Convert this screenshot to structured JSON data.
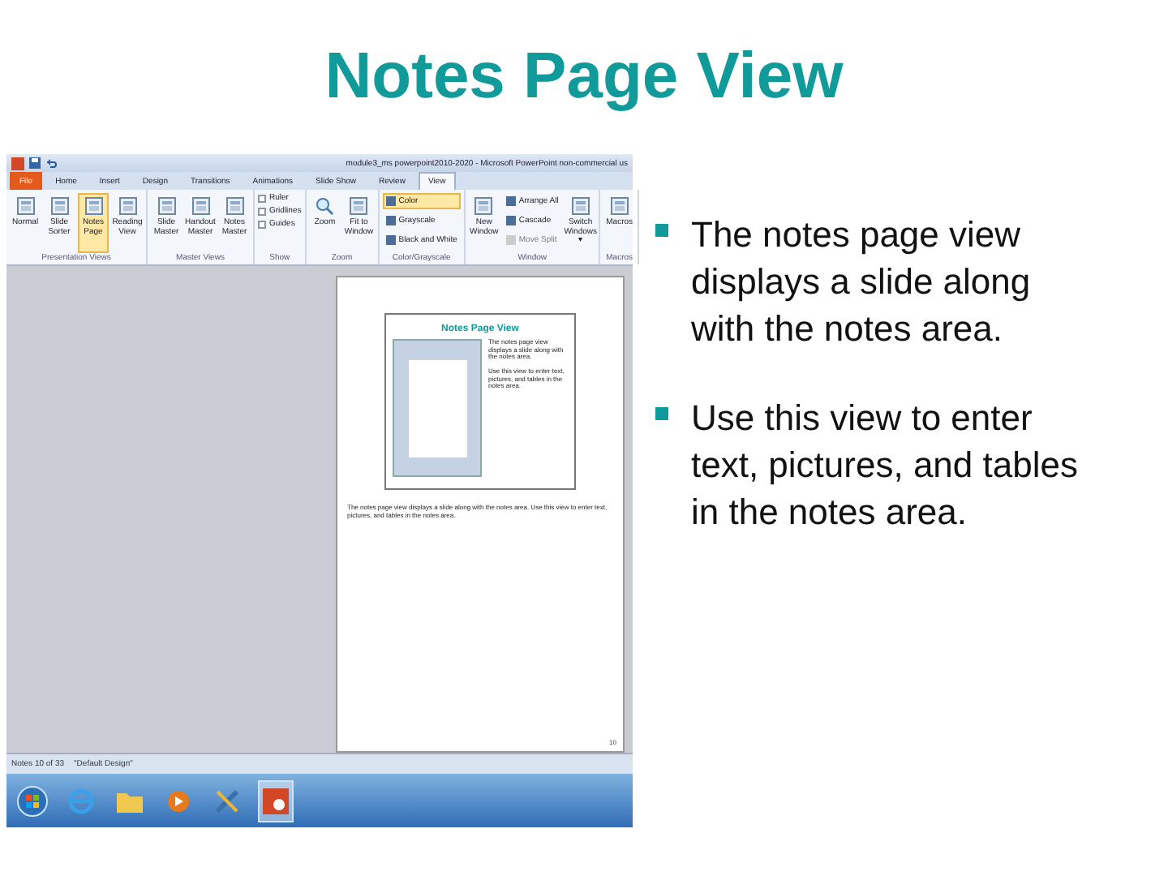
{
  "slide": {
    "title": "Notes Page View",
    "bullets": [
      "The notes page view displays a slide along with the notes area.",
      "Use this view to enter text, pictures, and tables in the notes area."
    ]
  },
  "app": {
    "window_title": "module3_ms powerpoint2010-2020 - Microsoft PowerPoint non-commercial us",
    "tabs": [
      {
        "label": "File",
        "kind": "file",
        "selected": false
      },
      {
        "label": "Home",
        "kind": "tab",
        "selected": false
      },
      {
        "label": "Insert",
        "kind": "tab",
        "selected": false
      },
      {
        "label": "Design",
        "kind": "tab",
        "selected": false
      },
      {
        "label": "Transitions",
        "kind": "tab",
        "selected": false
      },
      {
        "label": "Animations",
        "kind": "tab",
        "selected": false
      },
      {
        "label": "Slide Show",
        "kind": "tab",
        "selected": false
      },
      {
        "label": "Review",
        "kind": "tab",
        "selected": false
      },
      {
        "label": "View",
        "kind": "tab",
        "selected": true
      }
    ],
    "ribbon_groups": [
      {
        "label": "Presentation Views",
        "items": [
          {
            "kind": "large",
            "label": "Normal",
            "selected": false,
            "disabled": false
          },
          {
            "kind": "large",
            "label": "Slide Sorter",
            "selected": false,
            "disabled": false
          },
          {
            "kind": "large",
            "label": "Notes Page",
            "selected": true,
            "disabled": false
          },
          {
            "kind": "large",
            "label": "Reading View",
            "selected": false,
            "disabled": false
          }
        ]
      },
      {
        "label": "Master Views",
        "items": [
          {
            "kind": "large",
            "label": "Slide Master",
            "selected": false,
            "disabled": false
          },
          {
            "kind": "large",
            "label": "Handout Master",
            "selected": false,
            "disabled": false
          },
          {
            "kind": "large",
            "label": "Notes Master",
            "selected": false,
            "disabled": false
          }
        ]
      },
      {
        "label": "Show",
        "items": [
          {
            "kind": "check",
            "label": "Ruler",
            "checked": false,
            "disabled": false
          },
          {
            "kind": "check",
            "label": "Gridlines",
            "checked": false,
            "disabled": false
          },
          {
            "kind": "check",
            "label": "Guides",
            "checked": false,
            "disabled": false
          }
        ]
      },
      {
        "label": "Zoom",
        "items": [
          {
            "kind": "zoom",
            "label": "Zoom",
            "selected": false,
            "disabled": false
          },
          {
            "kind": "large",
            "label": "Fit to Window",
            "selected": false,
            "disabled": false
          }
        ]
      },
      {
        "label": "Color/Grayscale",
        "items": [
          {
            "kind": "small",
            "label": "Color",
            "selected": true,
            "disabled": false
          },
          {
            "kind": "small",
            "label": "Grayscale",
            "selected": false,
            "disabled": false
          },
          {
            "kind": "small",
            "label": "Black and White",
            "selected": false,
            "disabled": false
          }
        ]
      },
      {
        "label": "Window",
        "items": [
          {
            "kind": "large",
            "label": "New Window",
            "selected": false,
            "disabled": false
          },
          {
            "kind": "small",
            "label": "Arrange All",
            "selected": false,
            "disabled": false
          },
          {
            "kind": "small",
            "label": "Cascade",
            "selected": false,
            "disabled": false
          },
          {
            "kind": "small",
            "label": "Move Split",
            "selected": false,
            "disabled": true
          },
          {
            "kind": "large",
            "label": "Switch Windows ▾",
            "selected": false,
            "disabled": false
          }
        ]
      },
      {
        "label": "Macros",
        "items": [
          {
            "kind": "large",
            "label": "Macros",
            "selected": false,
            "disabled": false
          }
        ]
      }
    ],
    "notes_page": {
      "slide_title": "Notes Page View",
      "slide_bullets": [
        "The notes page view displays a slide along with the notes area.",
        "Use this view to enter text, pictures, and tables in the notes area."
      ],
      "notes": "The notes page view displays a slide along with the notes area. Use this view to enter text, pictures, and tables in the notes area.",
      "page_number": "10"
    },
    "status_bar": [
      "Notes 10 of 33",
      "\"Default Design\""
    ]
  }
}
